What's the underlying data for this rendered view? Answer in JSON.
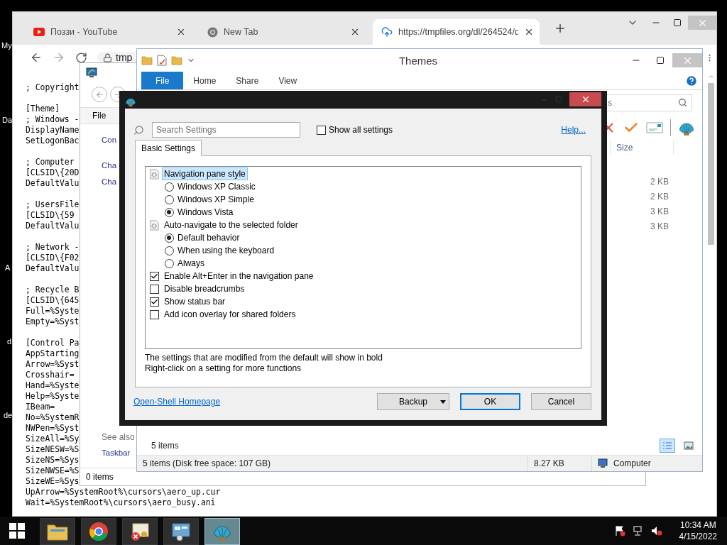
{
  "desktop": {
    "icon_labels": [
      "My",
      "Da",
      "A",
      "d",
      "de"
    ]
  },
  "browser": {
    "tabs": [
      {
        "kind": "video",
        "title": "Поззи - YouTube",
        "selected": false
      },
      {
        "kind": "browser",
        "title": "New Tab",
        "selected": false
      },
      {
        "kind": "upload",
        "title": "https://tmpfiles.org/dl/264524/d",
        "selected": true
      }
    ],
    "address": "tmp",
    "file_blocks": [
      [
        "; Copyright"
      ],
      [
        "[Theme]",
        "; Windows -",
        "DisplayName",
        "SetLogonBac"
      ],
      [
        "; Computer",
        "[CLSID\\{20D",
        "DefaultValu"
      ],
      [
        "; UsersFile",
        "[CLSID\\{59",
        "DefaultValu"
      ],
      [
        "; Network -",
        "[CLSID\\{F02",
        "DefaultValu"
      ],
      [
        "; Recycle B",
        "[CLSID\\{645",
        "Full=%Syste",
        "Empty=%Syst"
      ],
      [
        "[Control Pa",
        "AppStarting",
        "Arrow=%Syst",
        "Crosshair=",
        "Hand=%Syste",
        "Help=%Syste",
        "IBeam=",
        "No=%SystemR",
        "NWPen=%Syst",
        "SizeAll=%Sy",
        "SizeNESW=%S",
        "SizeNS=%Sys",
        "SizeNWSE=%S",
        "SizeWE=%Sys",
        "UpArrow=%SystemRoot%\\cursors\\aero_up.cur",
        "Wait=%SystemRoot%\\cursors\\aero_busy.ani"
      ]
    ]
  },
  "control_panel": {
    "menu": [
      "File"
    ],
    "links": [
      "Con",
      "Cha",
      "Cha"
    ],
    "see_also_heading": "See also",
    "see_also": [
      "Taskbar"
    ],
    "status": "0 items"
  },
  "explorer": {
    "title": "Themes",
    "ribbon_tabs": [
      {
        "label": "File",
        "selected": true
      },
      {
        "label": "Home",
        "selected": false
      },
      {
        "label": "Share",
        "selected": false
      },
      {
        "label": "View",
        "selected": false
      }
    ],
    "search_placeholder": "s",
    "size_column": "Size",
    "sizes": [
      "2 KB",
      "2 KB",
      "3 KB",
      "3 KB"
    ],
    "item_count": "5 items",
    "status_bar": {
      "items": "5 items (Disk free space: 107 GB)",
      "size": "8.27 KB",
      "location": "Computer"
    }
  },
  "dialog": {
    "search_placeholder": "Search Settings",
    "show_all": {
      "label": "Show all settings",
      "checked": false
    },
    "help": "Help...",
    "tabs": [
      {
        "label": "Basic Settings",
        "selected": true
      }
    ],
    "settings": [
      {
        "kind": "group",
        "label": "Navigation pane style",
        "selected": true,
        "children": [
          {
            "kind": "radio",
            "label": "Windows XP Classic",
            "checked": false
          },
          {
            "kind": "radio",
            "label": "Windows XP Simple",
            "checked": false
          },
          {
            "kind": "radio",
            "label": "Windows Vista",
            "checked": true
          }
        ]
      },
      {
        "kind": "group",
        "label": "Auto-navigate to the selected folder",
        "selected": false,
        "children": [
          {
            "kind": "radio",
            "label": "Default behavior",
            "checked": true
          },
          {
            "kind": "radio",
            "label": "When using the keyboard",
            "checked": false
          },
          {
            "kind": "radio",
            "label": "Always",
            "checked": false
          }
        ]
      },
      {
        "kind": "checkbox",
        "label": "Enable Alt+Enter in the navigation pane",
        "selected": false,
        "checked": true
      },
      {
        "kind": "checkbox",
        "label": "Disable breadcrumbs",
        "selected": false,
        "checked": false
      },
      {
        "kind": "checkbox",
        "label": "Show status bar",
        "selected": false,
        "checked": true
      },
      {
        "kind": "checkbox",
        "label": "Add icon overlay for shared folders",
        "selected": false,
        "checked": false
      }
    ],
    "notes": [
      "The settings that are modified from the default will show in bold",
      "Right-click on a setting for more functions"
    ],
    "homepage_link": "Open-Shell Homepage",
    "buttons": [
      {
        "kind": "menu",
        "label": "Backup"
      },
      {
        "kind": "default",
        "label": "OK"
      },
      {
        "kind": "plain",
        "label": "Cancel"
      }
    ]
  },
  "taskbar": {
    "apps": [
      {
        "kind": "folder",
        "selected": false
      },
      {
        "kind": "browser",
        "selected": false
      },
      {
        "kind": "certificate",
        "selected": false
      },
      {
        "kind": "control-panel",
        "selected": false
      },
      {
        "kind": "shell",
        "selected": true
      }
    ],
    "clock": {
      "time": "10:34 AM",
      "date": "4/15/2022"
    }
  }
}
